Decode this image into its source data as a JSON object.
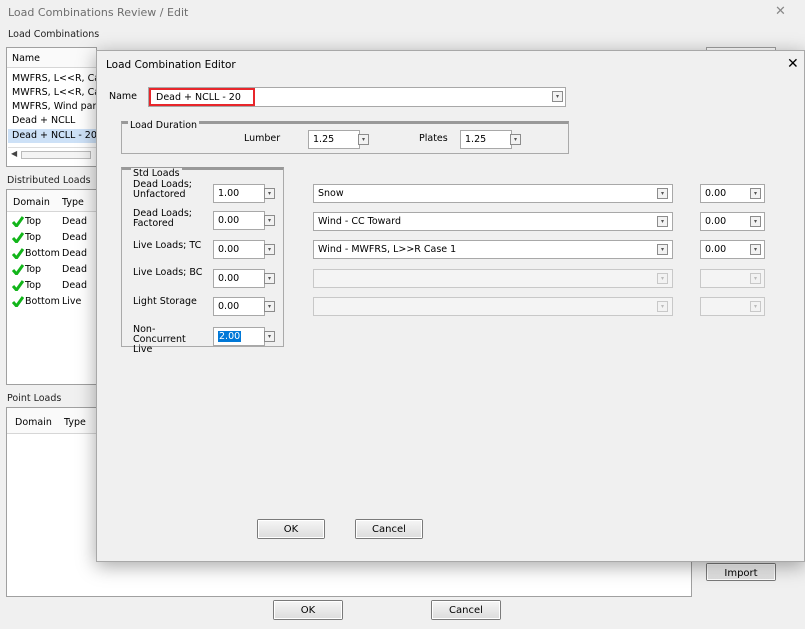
{
  "background": {
    "title": "Load Combinations Review / Edit",
    "section_label": "Load Combinations",
    "list_header": "Name",
    "combos": [
      "MWFRS, L<<R, Ca",
      "MWFRS, L<<R, Ca",
      "MWFRS, Wind parl",
      "Dead + NCLL",
      "Dead + NCLL - 20"
    ],
    "distributed_label": "Distributed Loads",
    "dist_headers": {
      "domain": "Domain",
      "type": "Type"
    },
    "dist_rows": [
      {
        "domain": "Top",
        "type": "Dead"
      },
      {
        "domain": "Top",
        "type": "Dead"
      },
      {
        "domain": "Bottom",
        "type": "Dead"
      },
      {
        "domain": "Top",
        "type": "Dead"
      },
      {
        "domain": "Top",
        "type": "Dead"
      },
      {
        "domain": "Bottom",
        "type": "Live"
      }
    ],
    "point_label": "Point Loads",
    "point_headers": {
      "domain": "Domain",
      "type": "Type"
    },
    "import_label": "Import",
    "ok_label": "OK",
    "cancel_label": "Cancel"
  },
  "editor": {
    "title": "Load Combination Editor",
    "name_label": "Name",
    "name_value": "Dead + NCLL - 20",
    "load_duration_label": "Load Duration",
    "lumber_label": "Lumber",
    "lumber_value": "1.25",
    "plates_label": "Plates",
    "plates_value": "1.25",
    "std_loads_label": "Std Loads",
    "std_loads": [
      {
        "label": "Dead Loads; Unfactored",
        "value": "1.00"
      },
      {
        "label": "Dead Loads; Factored",
        "value": "0.00"
      },
      {
        "label": "Live Loads; TC",
        "value": "0.00"
      },
      {
        "label": "Live Loads; BC",
        "value": "0.00"
      },
      {
        "label": "Light Storage",
        "value": "0.00"
      },
      {
        "label": "Non-Concurrent Live",
        "value": "2.00"
      }
    ],
    "other_loads": [
      {
        "name": "Snow",
        "value": "0.00"
      },
      {
        "name": "Wind - CC Toward",
        "value": "0.00"
      },
      {
        "name": "Wind - MWFRS, L>>R Case 1",
        "value": "0.00"
      },
      {
        "name": "",
        "value": ""
      },
      {
        "name": "",
        "value": ""
      }
    ],
    "ok_label": "OK",
    "cancel_label": "Cancel",
    "highlight_color": "#e8262b",
    "selection_color": "#0078d7"
  }
}
